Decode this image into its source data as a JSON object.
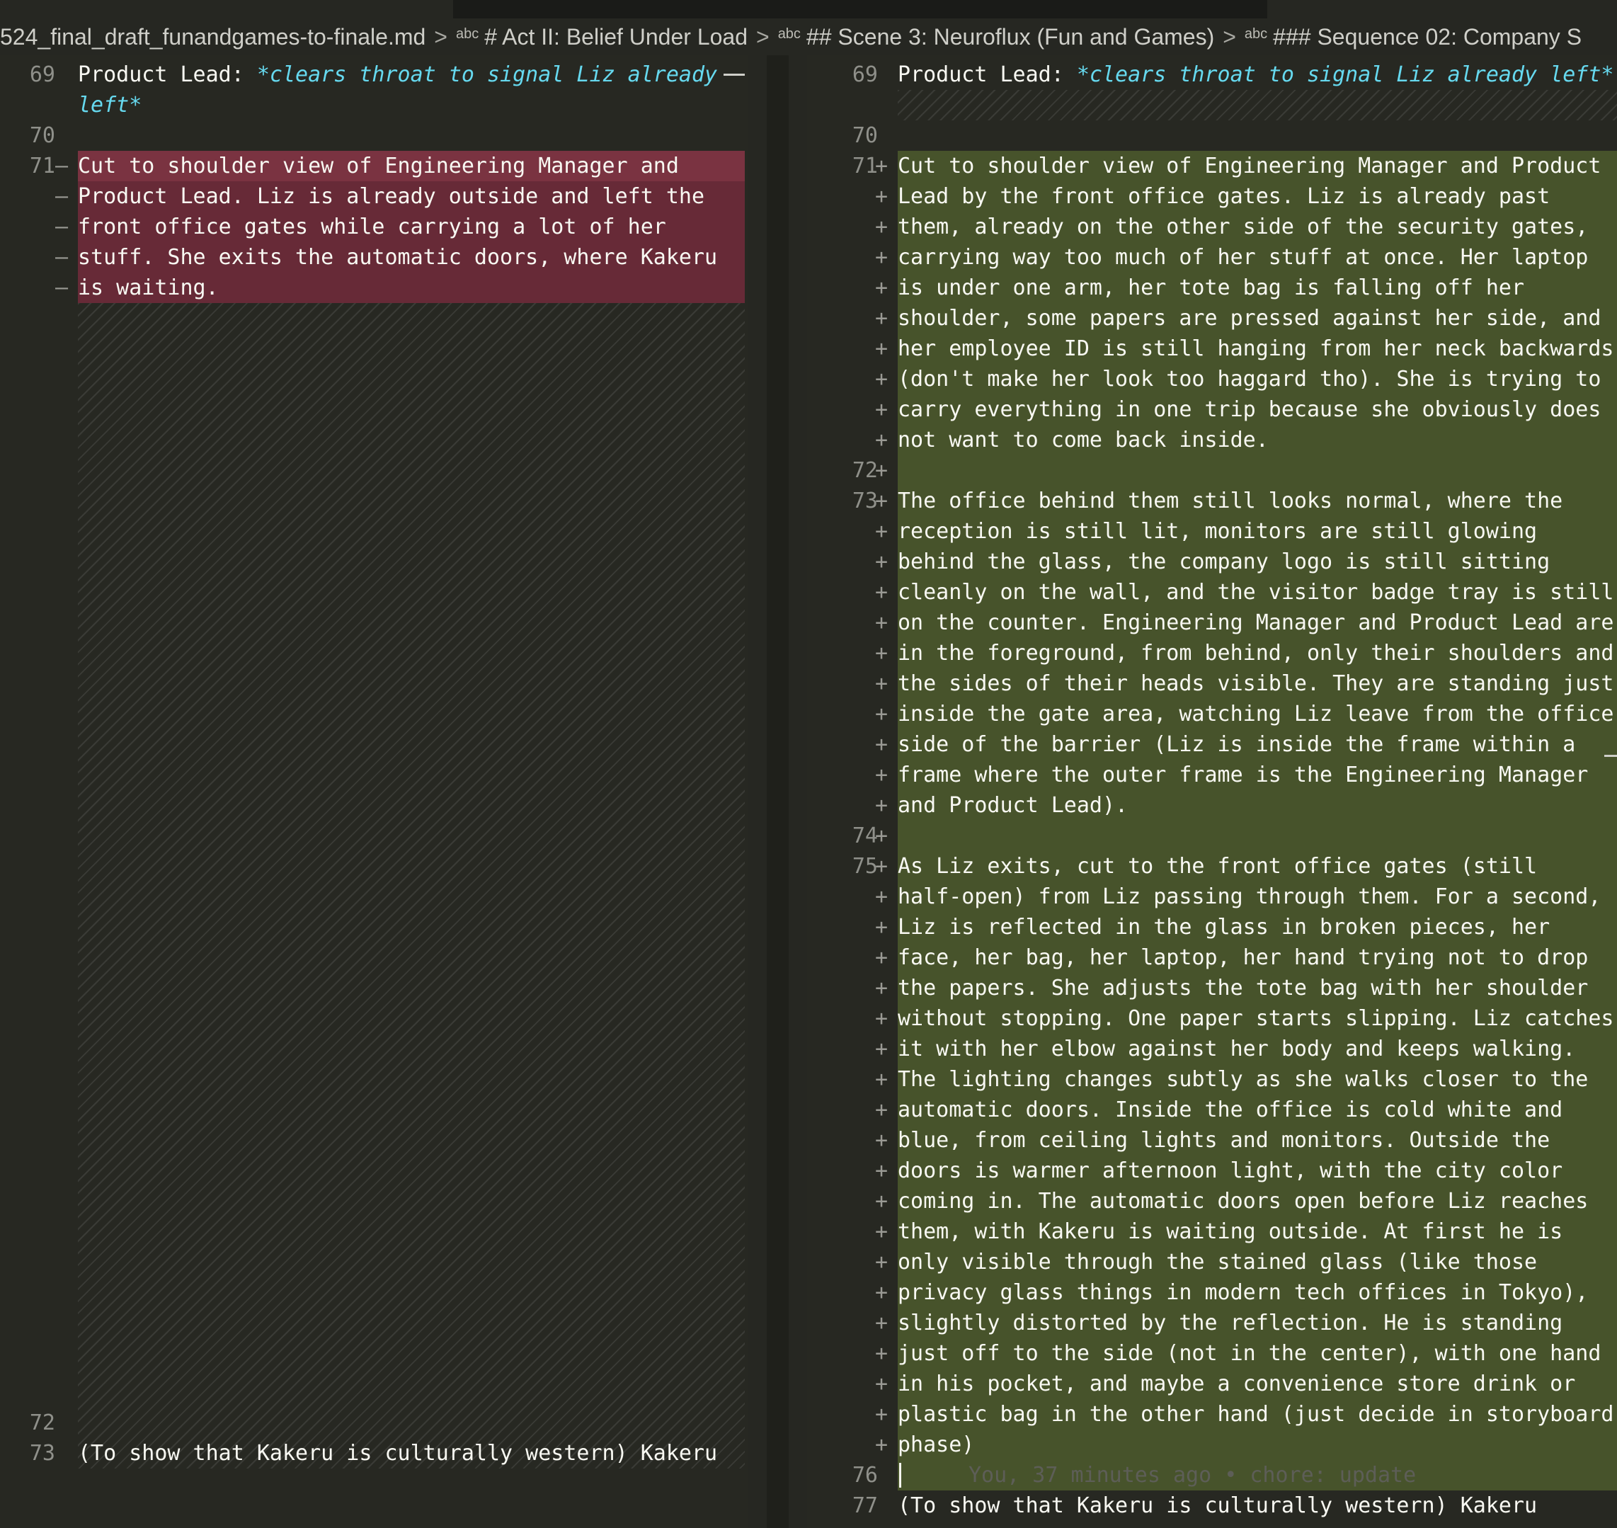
{
  "breadcrumb": {
    "file": "524_final_draft_funandgames-to-finale.md",
    "sections": [
      {
        "badge": "abc",
        "label": "# Act II: Belief Under Load"
      },
      {
        "badge": "abc",
        "label": "## Scene 3: Neuroflux (Fun and Games)"
      },
      {
        "badge": "abc",
        "label": "### Sequence 02: Company S"
      }
    ],
    "separator": ">"
  },
  "left": {
    "lines": [
      {
        "num": "69",
        "mark": "",
        "key": "Product Lead: ",
        "em": "*clears throat to signal Liz already"
      },
      {
        "num": "",
        "mark": "",
        "em": "left*"
      },
      {
        "num": "70",
        "mark": "",
        "text": ""
      },
      {
        "num": "71",
        "mark": "—",
        "text": "Cut to shoulder view of Engineering Manager and"
      },
      {
        "num": "",
        "mark": "—",
        "text": "Product Lead. Liz is already outside and left the"
      },
      {
        "num": "",
        "mark": "—",
        "text": "front office gates while carrying a lot of her"
      },
      {
        "num": "",
        "mark": "—",
        "text": "stuff. She exits the automatic doors, where Kakeru"
      },
      {
        "num": "",
        "mark": "—",
        "text": "is waiting."
      },
      {
        "num": "72",
        "mark": "",
        "text": ""
      },
      {
        "num": "73",
        "mark": "",
        "text": "(To show that Kakeru is culturally western) Kakeru"
      }
    ],
    "change_mark": "—"
  },
  "right": {
    "lines": [
      {
        "num": "69",
        "mark": "",
        "key": "Product Lead: ",
        "em": "*clears throat to signal Liz already left*"
      },
      {
        "num": "70",
        "mark": "",
        "text": ""
      },
      {
        "num": "71",
        "mark": "+",
        "text": "Cut to shoulder view of Engineering Manager and Product"
      },
      {
        "num": "",
        "mark": "+",
        "text": "Lead by the front office gates. Liz is already past"
      },
      {
        "num": "",
        "mark": "+",
        "text": "them, already on the other side of the security gates,"
      },
      {
        "num": "",
        "mark": "+",
        "text": "carrying way too much of her stuff at once. Her laptop"
      },
      {
        "num": "",
        "mark": "+",
        "text": "is under one arm, her tote bag is falling off her"
      },
      {
        "num": "",
        "mark": "+",
        "text": "shoulder, some papers are pressed against her side, and"
      },
      {
        "num": "",
        "mark": "+",
        "text": "her employee ID is still hanging from her neck backwards"
      },
      {
        "num": "",
        "mark": "+",
        "text": "(don't make her look too haggard tho). She is trying to"
      },
      {
        "num": "",
        "mark": "+",
        "text": "carry everything in one trip because she obviously does"
      },
      {
        "num": "",
        "mark": "+",
        "text": "not want to come back inside."
      },
      {
        "num": "72",
        "mark": "+",
        "text": ""
      },
      {
        "num": "73",
        "mark": "+",
        "text": "The office behind them still looks normal, where the"
      },
      {
        "num": "",
        "mark": "+",
        "text": "reception is still lit, monitors are still glowing"
      },
      {
        "num": "",
        "mark": "+",
        "text": "behind the glass, the company logo is still sitting"
      },
      {
        "num": "",
        "mark": "+",
        "text": "cleanly on the wall, and the visitor badge tray is still"
      },
      {
        "num": "",
        "mark": "+",
        "text": "on the counter. Engineering Manager and Product Lead are"
      },
      {
        "num": "",
        "mark": "+",
        "text": "in the foreground, from behind, only their shoulders and"
      },
      {
        "num": "",
        "mark": "+",
        "text": "the sides of their heads visible. They are standing just"
      },
      {
        "num": "",
        "mark": "+",
        "text": "inside the gate area, watching Liz leave from the office"
      },
      {
        "num": "",
        "mark": "+",
        "text": "side of the barrier (Liz is inside the frame within a"
      },
      {
        "num": "",
        "mark": "+",
        "text": "frame where the outer frame is the Engineering Manager"
      },
      {
        "num": "",
        "mark": "+",
        "text": "and Product Lead)."
      },
      {
        "num": "74",
        "mark": "+",
        "text": ""
      },
      {
        "num": "75",
        "mark": "+",
        "text": "As Liz exits, cut to the front office gates (still"
      },
      {
        "num": "",
        "mark": "+",
        "text": "half-open) from Liz passing through them. For a second,"
      },
      {
        "num": "",
        "mark": "+",
        "text": "Liz is reflected in the glass in broken pieces, her"
      },
      {
        "num": "",
        "mark": "+",
        "text": "face, her bag, her laptop, her hand trying not to drop"
      },
      {
        "num": "",
        "mark": "+",
        "text": "the papers. She adjusts the tote bag with her shoulder"
      },
      {
        "num": "",
        "mark": "+",
        "text": "without stopping. One paper starts slipping. Liz catches"
      },
      {
        "num": "",
        "mark": "+",
        "text": "it with her elbow against her body and keeps walking."
      },
      {
        "num": "",
        "mark": "+",
        "text": "The lighting changes subtly as she walks closer to the"
      },
      {
        "num": "",
        "mark": "+",
        "text": "automatic doors. Inside the office is cold white and"
      },
      {
        "num": "",
        "mark": "+",
        "text": "blue, from ceiling lights and monitors. Outside the"
      },
      {
        "num": "",
        "mark": "+",
        "text": "doors is warmer afternoon light, with the city color"
      },
      {
        "num": "",
        "mark": "+",
        "text": "coming in. The automatic doors open before Liz reaches"
      },
      {
        "num": "",
        "mark": "+",
        "text": "them, with Kakeru is waiting outside. At first he is"
      },
      {
        "num": "",
        "mark": "+",
        "text": "only visible through the stained glass (like those"
      },
      {
        "num": "",
        "mark": "+",
        "text": "privacy glass things in modern tech offices in Tokyo),"
      },
      {
        "num": "",
        "mark": "+",
        "text": "slightly distorted by the reflection. He is standing"
      },
      {
        "num": "",
        "mark": "+",
        "text": "just off to the side (not in the center), with one hand"
      },
      {
        "num": "",
        "mark": "+",
        "text": "in his pocket, and maybe a convenience store drink or"
      },
      {
        "num": "",
        "mark": "+",
        "text": "plastic bag in the other hand (just decide in storyboard"
      },
      {
        "num": "",
        "mark": "+",
        "text": "phase)"
      },
      {
        "num": "76",
        "mark": "",
        "text": "",
        "blame": "You, 37 minutes ago • chore: update"
      },
      {
        "num": "77",
        "mark": "",
        "text": "(To show that Kakeru is culturally western) Kakeru"
      }
    ]
  },
  "colors": {
    "deleted": "#672a37",
    "added": "#47532b",
    "italic_accent": "#66d9ef",
    "editor_bg": "#272822"
  }
}
